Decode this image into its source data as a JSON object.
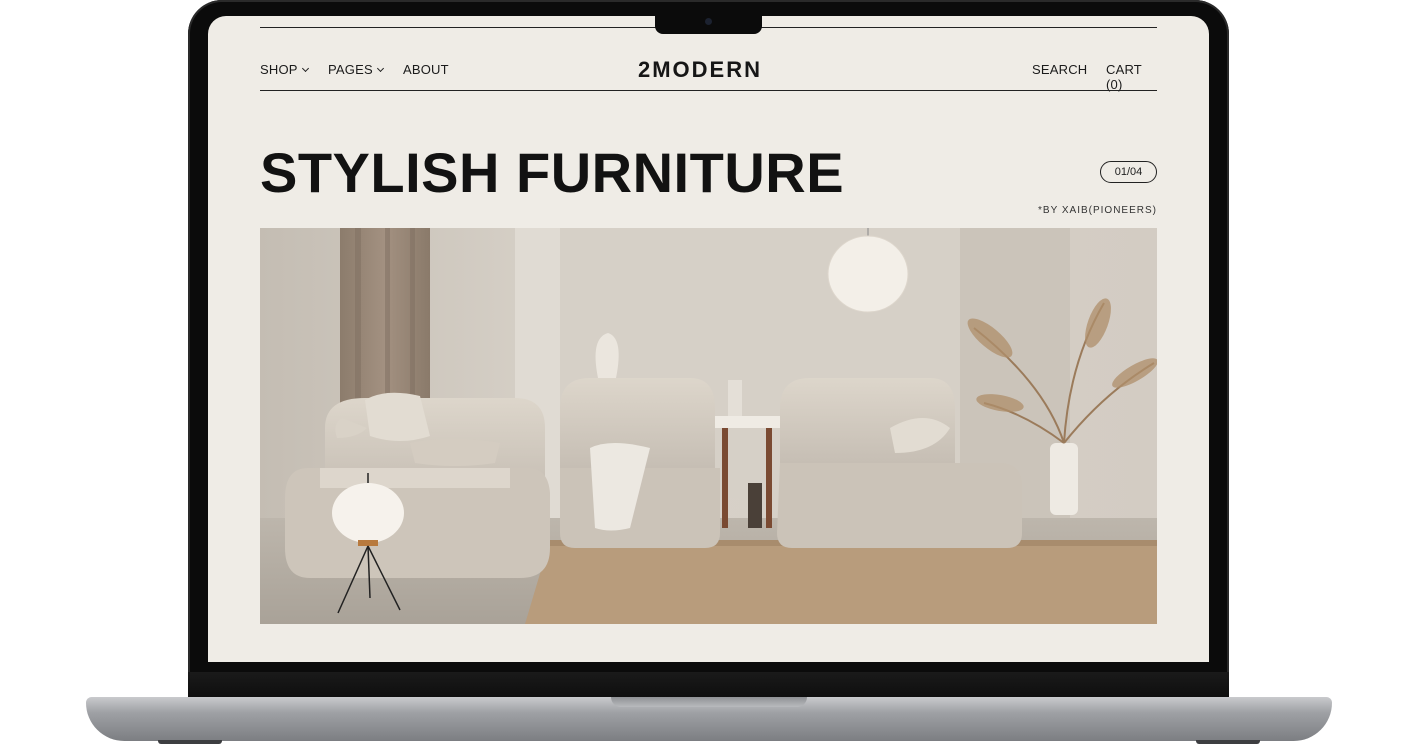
{
  "nav": {
    "shop": "SHOP",
    "pages": "PAGES",
    "about": "ABOUT",
    "search": "SEARCH",
    "cart": "CART (0)"
  },
  "brand": {
    "logo": "2MODERN"
  },
  "hero": {
    "title": "STYLISH FURNITURE",
    "pager": "01/04",
    "credit": "*BY XAIB(PIONEERS)"
  },
  "colors": {
    "page_bg": "#efece6",
    "text": "#121212",
    "frame": "#0b0b0b"
  }
}
